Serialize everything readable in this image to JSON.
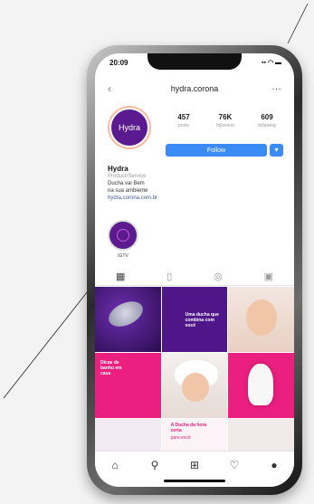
{
  "status": {
    "time": "20:09",
    "system": "▪▪ ◠ ▬"
  },
  "nav": {
    "back": "‹",
    "title": "hydra.corona",
    "more": "…"
  },
  "profile": {
    "avatar_text": "Hydra",
    "stats": [
      {
        "value": "457",
        "label": "posts"
      },
      {
        "value": "76K",
        "label": "followers"
      },
      {
        "value": "609",
        "label": "following"
      }
    ],
    "follow_label": "Follow",
    "follow_more": "▾",
    "name": "Hydra",
    "category": "Product/Service",
    "bio_line1": "Ducha vai Bem",
    "bio_line2": "na sua ambiente",
    "link": "hydra.corona.com.br"
  },
  "highlight": {
    "label": "IGTV"
  },
  "tabs": [
    "▦",
    "▯",
    "◎",
    "▣"
  ],
  "grid": {
    "cell2_text": "Uma ducha que combina com você",
    "cell4_text": "Dicas de banho em casa",
    "cell8_text": "A Ducha da hora certa",
    "cell8_caption": "para você"
  },
  "bottom_nav": [
    "⌂",
    "⚲",
    "⊞",
    "♡",
    "●"
  ],
  "colors": {
    "brand_purple": "#5b1a8f",
    "brand_pink": "#ea1f80",
    "follow_blue": "#3a8bf5"
  }
}
